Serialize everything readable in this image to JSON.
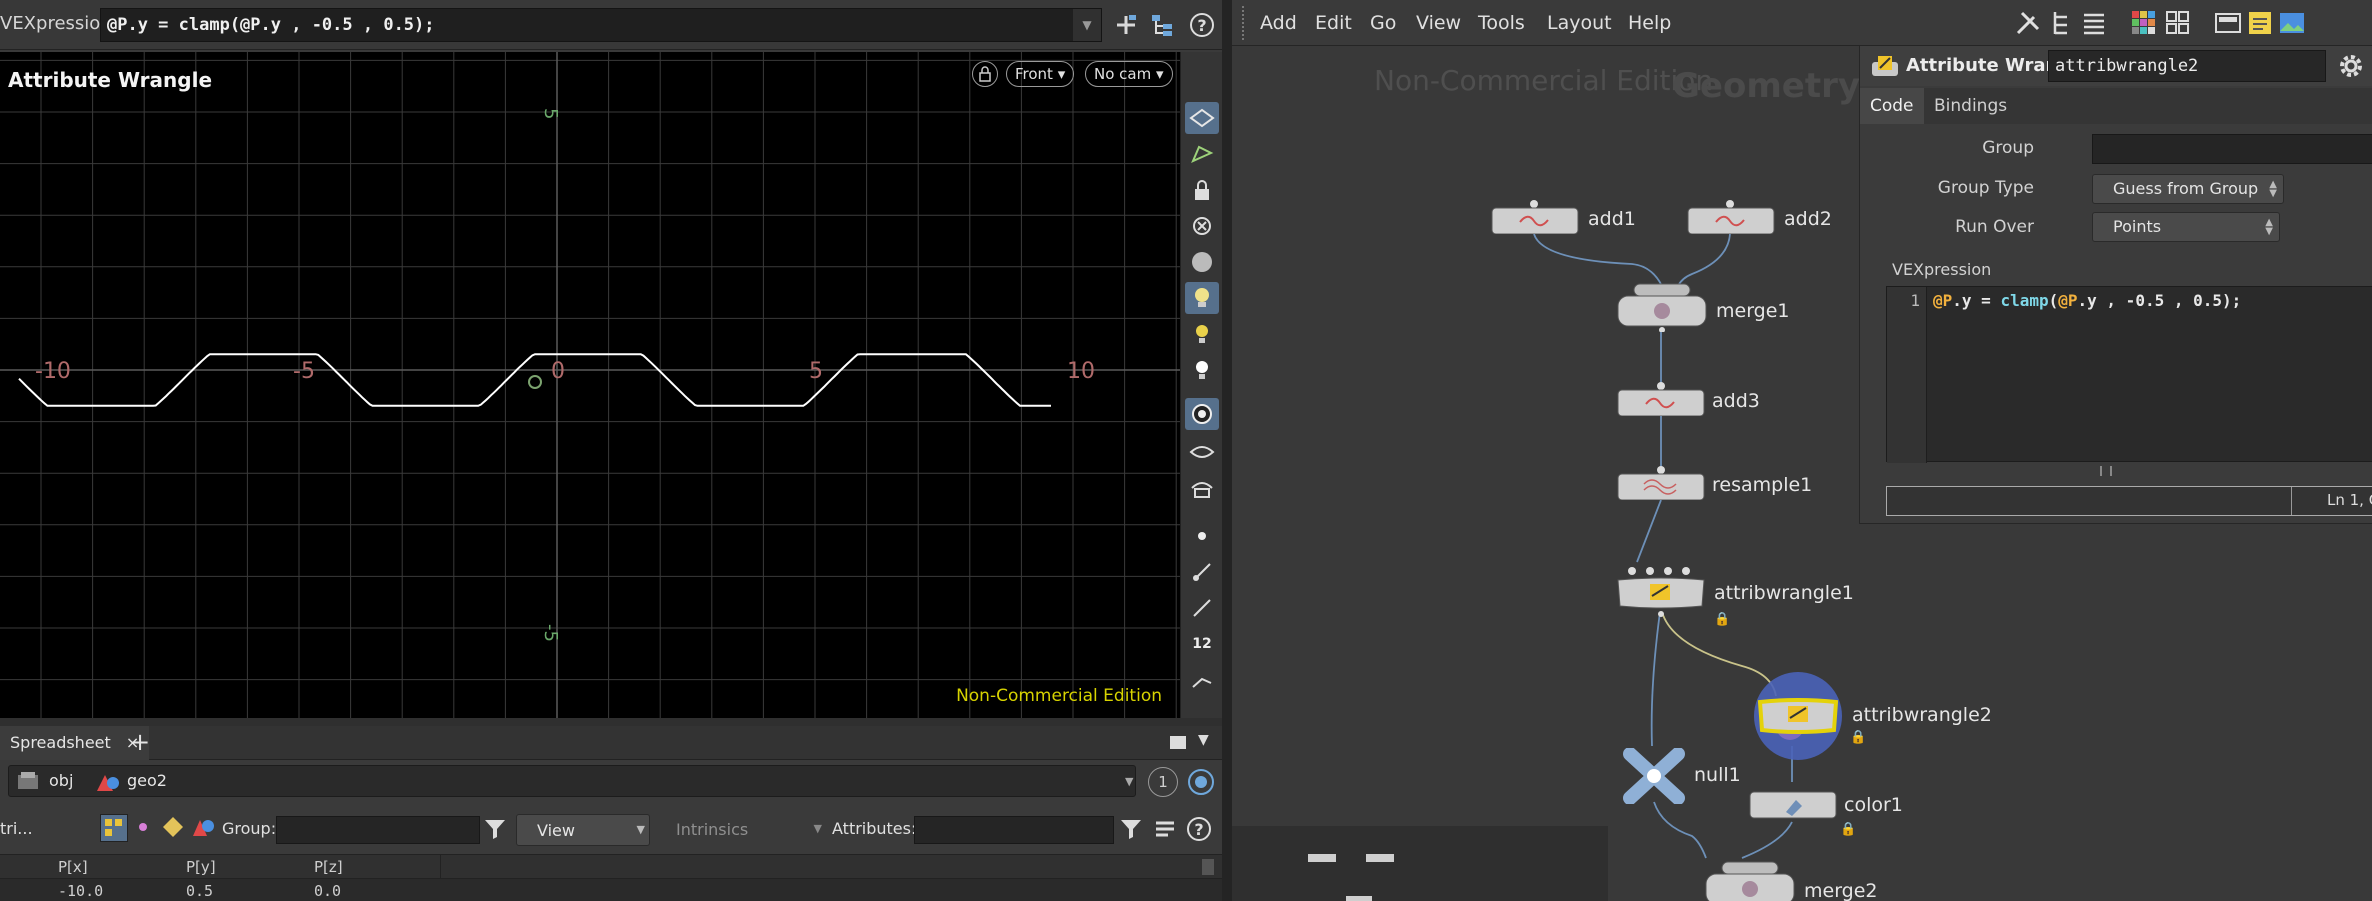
{
  "vex_bar": {
    "label": "VEXpression",
    "code": "@P.y = clamp(@P.y , -0.5 , 0.5);"
  },
  "viewport": {
    "title": "Attribute Wrangle",
    "view_label": "Front",
    "cam_label": "No cam",
    "watermark": "Non-Commercial Edition",
    "x_axis_labels": [
      "-10",
      "-5",
      "0",
      "5",
      "10"
    ],
    "y_axis_labels": [
      "5",
      "0",
      "-5"
    ],
    "tool_badge": "12"
  },
  "spreadsheet": {
    "tab_label": "Spreadsheet",
    "close_glyph": "×",
    "add_glyph": "+",
    "path": [
      "obj",
      "geo2"
    ],
    "pin_number": "1",
    "attrib_class_label": "tri...",
    "group_label": "Group:",
    "view_label": "View",
    "intrinsics_label": "Intrinsics",
    "attributes_label": "Attributes:",
    "columns": [
      "P[x]",
      "P[y]",
      "P[z]"
    ],
    "rows": [
      [
        "-10.0",
        "0.5",
        "0.0"
      ]
    ]
  },
  "menubar": {
    "items": [
      "Add",
      "Edit",
      "Go",
      "View",
      "Tools",
      "Layout",
      "Help"
    ]
  },
  "network": {
    "watermark": "Non-Commercial Edition",
    "context_label": "Geometry",
    "nodes": {
      "add1": "add1",
      "add2": "add2",
      "merge1": "merge1",
      "add3": "add3",
      "resample1": "resample1",
      "attribwrangle1": "attribwrangle1",
      "attribwrangle2": "attribwrangle2",
      "null1": "null1",
      "color1": "color1",
      "merge2": "merge2"
    }
  },
  "params": {
    "node_type": "Attribute Wrangle",
    "node_name": "attribwrangle2",
    "tabs": [
      "Code",
      "Bindings"
    ],
    "group_label": "Group",
    "group_value": "",
    "group_type_label": "Group Type",
    "group_type_value": "Guess from Group",
    "run_over_label": "Run Over",
    "run_over_value": "Points",
    "vex_label": "VEXpression",
    "line_number": "1",
    "code_tokens": {
      "a": "@P",
      "b": ".y = ",
      "c": "clamp",
      "d": "(",
      "e": "@P",
      "f": ".y , -0.5 , 0.5);"
    },
    "status_position": "Ln 1, C"
  },
  "colors": {
    "accent_selected": "#56708c",
    "watermark_yellow": "#d7d300",
    "selected_node": "#e4d20a",
    "code_attr": "#f2b13e",
    "code_func": "#7fd8e8"
  }
}
